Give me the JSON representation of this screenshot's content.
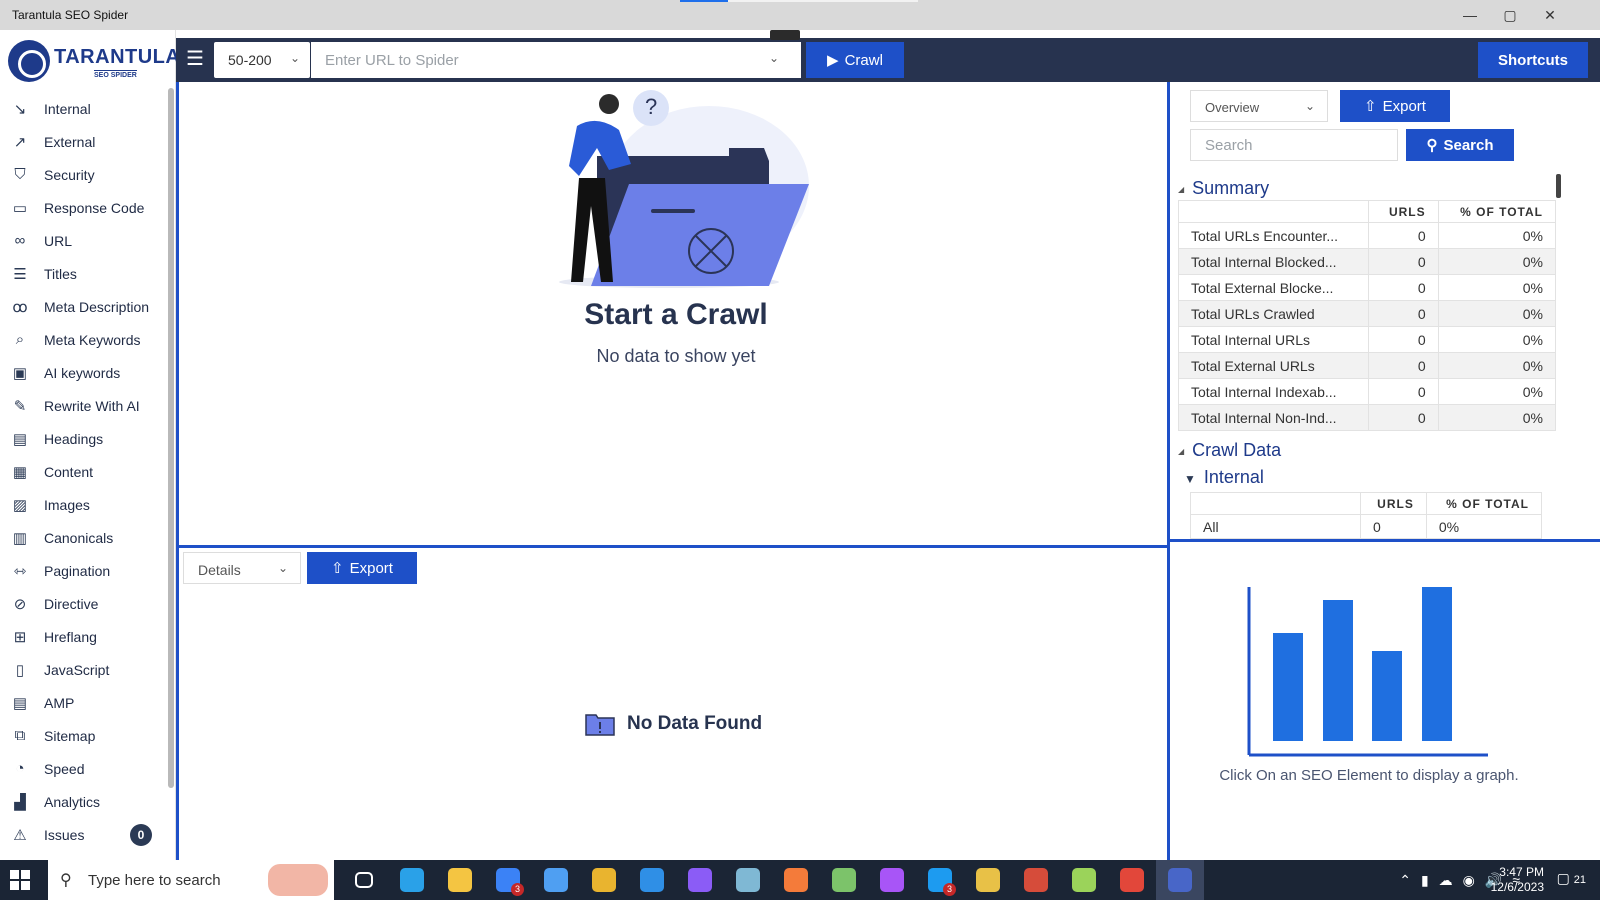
{
  "window": {
    "title": "Tarantula SEO Spider",
    "controls": {
      "minimize": "—",
      "maximize": "▢",
      "close": "✕"
    }
  },
  "brand": {
    "name": "TARANTULA",
    "tagline": "SEO SPIDER",
    "color": "#1e3a8a"
  },
  "sidebar": {
    "items": [
      {
        "label": "Internal",
        "icon": "internal-icon",
        "glyph": "↘"
      },
      {
        "label": "External",
        "icon": "external-link-icon",
        "glyph": "↗"
      },
      {
        "label": "Security",
        "icon": "shield-icon",
        "glyph": "⛉"
      },
      {
        "label": "Response Code",
        "icon": "code-icon",
        "glyph": "▭"
      },
      {
        "label": "URL",
        "icon": "link-icon",
        "glyph": "∞"
      },
      {
        "label": "Titles",
        "icon": "titles-icon",
        "glyph": "☰"
      },
      {
        "label": "Meta Description",
        "icon": "glasses-icon",
        "glyph": "ꝏ"
      },
      {
        "label": "Meta Keywords",
        "icon": "search-icon",
        "glyph": "⌕"
      },
      {
        "label": "AI keywords",
        "icon": "ai-icon",
        "glyph": "▣"
      },
      {
        "label": "Rewrite With AI",
        "icon": "rewrite-icon",
        "glyph": "✎"
      },
      {
        "label": "Headings",
        "icon": "headings-icon",
        "glyph": "▤"
      },
      {
        "label": "Content",
        "icon": "content-icon",
        "glyph": "▦"
      },
      {
        "label": "Images",
        "icon": "image-icon",
        "glyph": "▨"
      },
      {
        "label": "Canonicals",
        "icon": "canonicals-icon",
        "glyph": "▥"
      },
      {
        "label": "Pagination",
        "icon": "pagination-icon",
        "glyph": "⇿"
      },
      {
        "label": "Directive",
        "icon": "compass-icon",
        "glyph": "⊘"
      },
      {
        "label": "Hreflang",
        "icon": "hreflang-icon",
        "glyph": "⊞"
      },
      {
        "label": "JavaScript",
        "icon": "javascript-icon",
        "glyph": "▯"
      },
      {
        "label": "AMP",
        "icon": "amp-icon",
        "glyph": "▤"
      },
      {
        "label": "Sitemap",
        "icon": "sitemap-icon",
        "glyph": "⧉"
      },
      {
        "label": "Speed",
        "icon": "speedometer-icon",
        "glyph": "◔"
      },
      {
        "label": "Analytics",
        "icon": "analytics-icon",
        "glyph": "▟"
      },
      {
        "label": "Issues",
        "icon": "warning-icon",
        "glyph": "⚠",
        "badge": "0"
      }
    ]
  },
  "toolbar": {
    "menu_glyph": "☰",
    "depth": "50-200",
    "url_placeholder": "Enter URL to Spider",
    "url_value": "",
    "crawl_label": "Crawl",
    "shortcuts_label": "Shortcuts"
  },
  "main": {
    "title": "Start a Crawl",
    "subtitle": "No data to show yet",
    "question_mark": "?"
  },
  "details": {
    "select": "Details",
    "export_label": "Export",
    "empty_label": "No Data Found"
  },
  "overview": {
    "select": "Overview",
    "export_label": "Export",
    "search_placeholder": "Search",
    "search_label": "Search",
    "summary_title": "Summary",
    "col_urls": "URLS",
    "col_pct": "% OF TOTAL",
    "rows": [
      {
        "label": "Total URLs Encounter...",
        "urls": "0",
        "pct": "0%"
      },
      {
        "label": "Total Internal Blocked...",
        "urls": "0",
        "pct": "0%"
      },
      {
        "label": "Total External Blocke...",
        "urls": "0",
        "pct": "0%"
      },
      {
        "label": "Total URLs Crawled",
        "urls": "0",
        "pct": "0%"
      },
      {
        "label": "Total Internal URLs",
        "urls": "0",
        "pct": "0%"
      },
      {
        "label": "Total External URLs",
        "urls": "0",
        "pct": "0%"
      },
      {
        "label": "Total Internal Indexab...",
        "urls": "0",
        "pct": "0%"
      },
      {
        "label": "Total Internal Non-Ind...",
        "urls": "0",
        "pct": "0%"
      }
    ],
    "crawl_data_title": "Crawl Data",
    "internal_title": "Internal",
    "internal_rows": [
      {
        "label": "All",
        "urls": "0",
        "pct": "0%"
      }
    ]
  },
  "graph": {
    "caption": "Click On an SEO Element to display a graph.",
    "bar_color": "#1f6fe0"
  },
  "taskbar": {
    "search_text": "Type here to search",
    "apps": [
      {
        "name": "task-view-icon",
        "color": "#ffffff"
      },
      {
        "name": "edge-icon",
        "color": "#2aa1e8"
      },
      {
        "name": "file-explorer-icon",
        "color": "#f4c542"
      },
      {
        "name": "mail-icon",
        "color": "#3b82f6",
        "count": "3"
      },
      {
        "name": "store-icon",
        "color": "#4f9ff2"
      },
      {
        "name": "chrome-icon",
        "color": "#e9b42f"
      },
      {
        "name": "vscode-icon",
        "color": "#2f8fe6"
      },
      {
        "name": "visual-studio-icon",
        "color": "#8b5cf6"
      },
      {
        "name": "app-icon",
        "color": "#7fb8d4"
      },
      {
        "name": "postman-icon",
        "color": "#f47b3a"
      },
      {
        "name": "notepad-icon",
        "color": "#7cc36a"
      },
      {
        "name": "github-icon",
        "color": "#a855f7"
      },
      {
        "name": "skype-icon",
        "color": "#1d9bf0",
        "count": "3"
      },
      {
        "name": "slack-icon",
        "color": "#e8c147"
      },
      {
        "name": "chrome-profile-icon",
        "color": "#d64c3a"
      },
      {
        "name": "xbox-icon",
        "color": "#9bd35a"
      },
      {
        "name": "chrome-alt-icon",
        "color": "#e2473a"
      },
      {
        "name": "tarantula-icon",
        "color": "#4866c8",
        "active": true
      }
    ],
    "time": "3:47 PM",
    "date": "12/6/2023",
    "notifications": "21"
  }
}
